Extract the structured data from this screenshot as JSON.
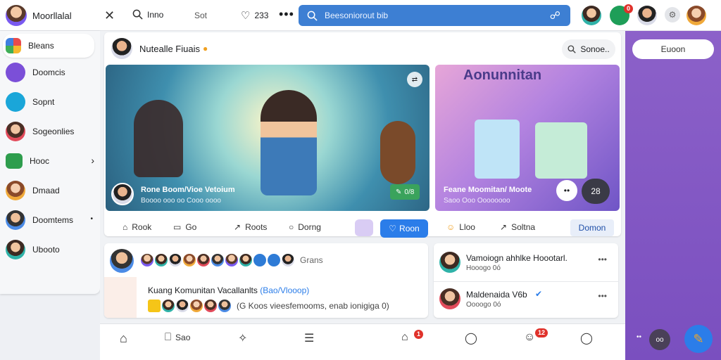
{
  "topbar": {
    "app_title": "Moorllalal",
    "close_icon": "close-icon",
    "search_label": "Inno",
    "sot_label": "Sot",
    "likes_count": "233",
    "search_placeholder": "Beesoniorout bib",
    "notification_count": "0"
  },
  "sidebar": {
    "items": [
      {
        "label": "Bleans"
      },
      {
        "label": "Doomcis"
      },
      {
        "label": "Sopnt"
      },
      {
        "label": "Sogeonlies"
      },
      {
        "label": "Hooc"
      },
      {
        "label": "Dmaad"
      },
      {
        "label": "Doomtems"
      },
      {
        "label": "Ubooto"
      }
    ]
  },
  "composer": {
    "title": "Nutealle Fiuais",
    "search_label": "Sonoe.."
  },
  "hero_left": {
    "caption": "Rone Boom/Vioe Vetoium",
    "subcaption": "Boooo ooo oo  Cooo oooo",
    "tag": "0/8"
  },
  "hero_right": {
    "title": "Aonunnitan",
    "caption": "Feane Moomitan/ Moote",
    "subcaption": "Saoo Ooo  Oooooooo",
    "tag": "28"
  },
  "actions_left": {
    "reply": "Rook",
    "comment": "Go",
    "share": "Roots",
    "search": "Dorng",
    "button": "Roon"
  },
  "actions_right": {
    "like": "Lloo",
    "share": "Soltna",
    "button": "Domon"
  },
  "post": {
    "more_label": "Grans",
    "title": "Kuang Komunitan Vacallanlts",
    "tag": "(Bao/Vlooop)",
    "subtitle": "(G Koos vieesfemooms, enab ionigiga 0)"
  },
  "suggest": [
    {
      "name": "Vamoiogn ahhlke Hoootarl.",
      "sub": "Hooogo 0ó"
    },
    {
      "name": "Maldenaida V6b",
      "sub": "Oooogo 0ó"
    }
  ],
  "bottomnav": {
    "home_label": "",
    "book_label": "Sao",
    "badge1": "1",
    "badge2": "12"
  },
  "rightrail": {
    "button": "Euoon"
  }
}
